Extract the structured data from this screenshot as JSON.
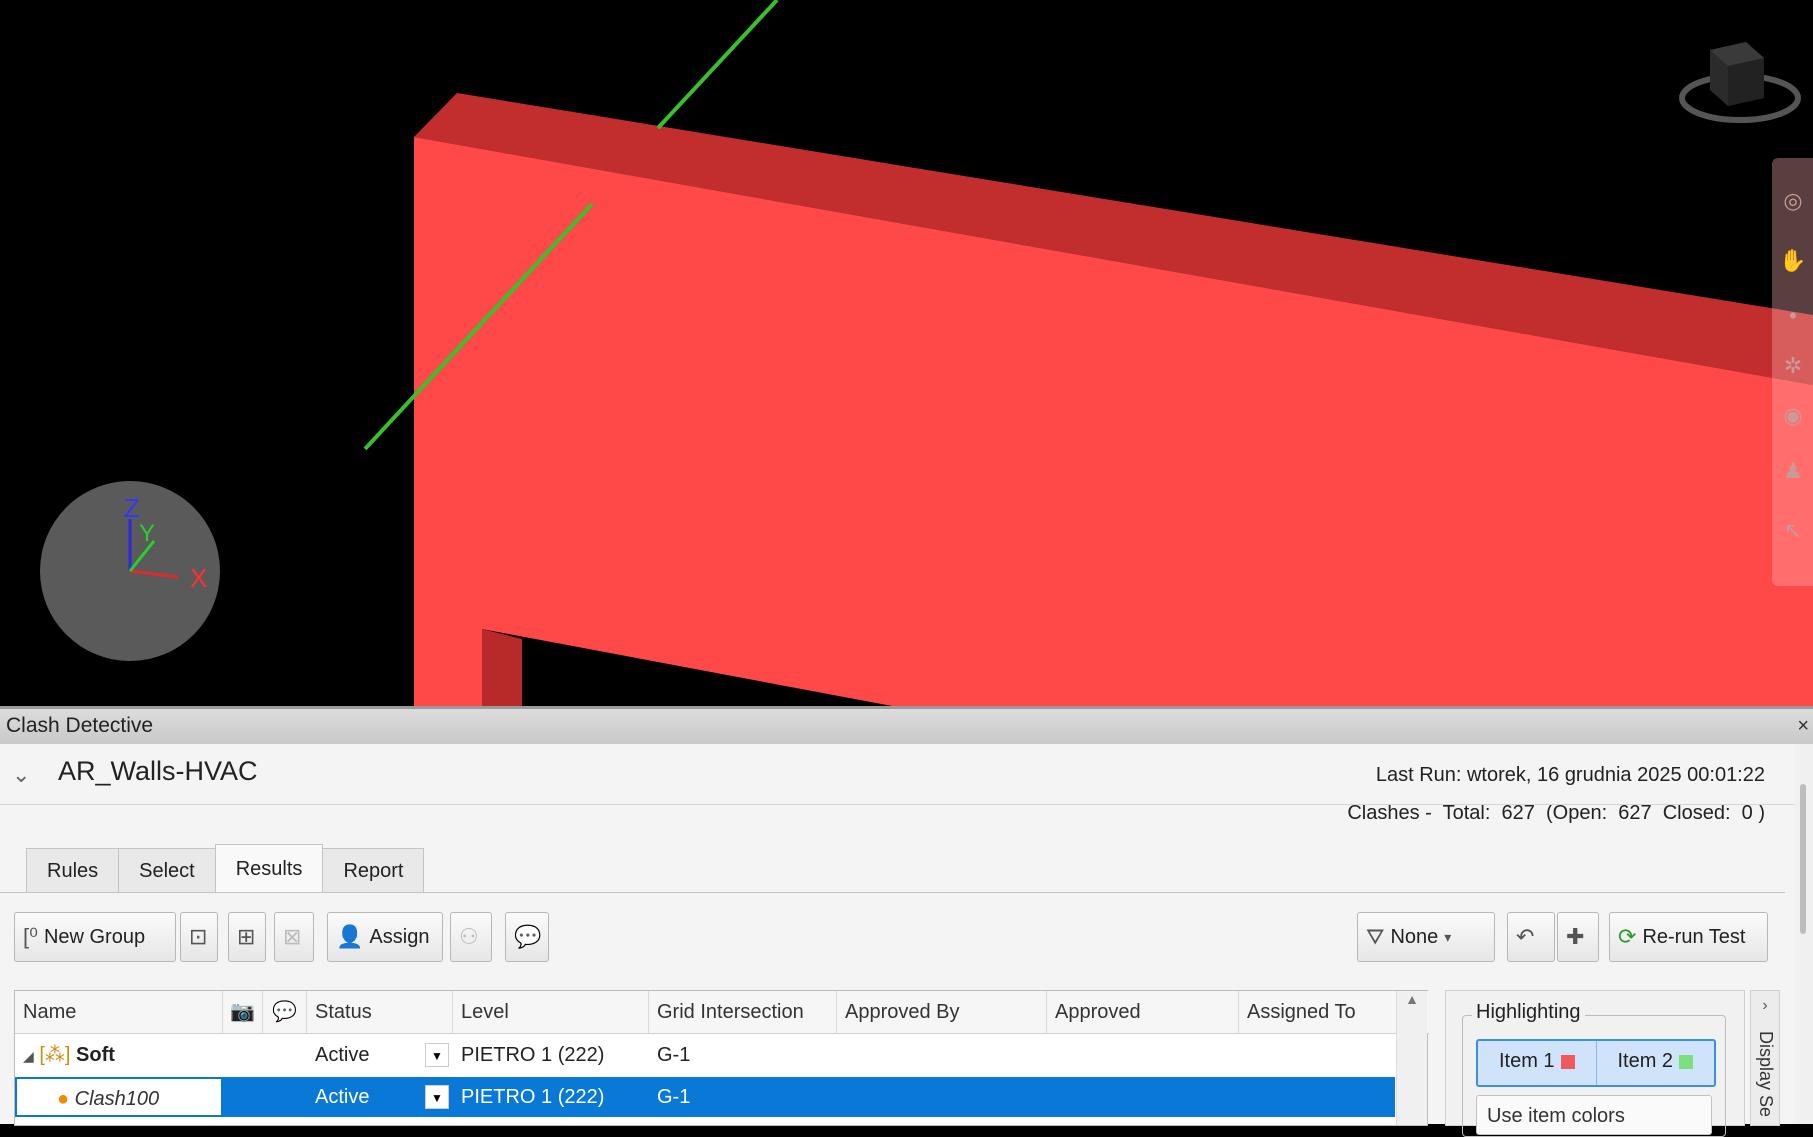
{
  "panel": {
    "title": "Clash Detective",
    "close_glyph": "×"
  },
  "test": {
    "name": "AR_Walls-HVAC",
    "last_run": "Last Run:  wtorek, 16 grudnia 2025 00:01:22",
    "clash_summary": "Clashes -  Total:  627  (Open:  627  Closed:  0 )"
  },
  "tabs": [
    "Rules",
    "Select",
    "Results",
    "Report"
  ],
  "active_tab": "Results",
  "toolbar": {
    "new_group": "New Group",
    "assign": "Assign",
    "filter": "None",
    "rerun": "Re-run Test"
  },
  "columns": [
    "Name",
    "Status",
    "Level",
    "Grid Intersection",
    "Approved By",
    "Approved",
    "Assigned To"
  ],
  "rows": [
    {
      "name": "Soft",
      "status": "Active",
      "level": "PIETRO 1 (222)",
      "grid": "G-1",
      "selected": false,
      "type": "group"
    },
    {
      "name": "Clash100",
      "status": "Active",
      "level": "PIETRO 1 (222)",
      "grid": "G-1",
      "selected": true,
      "type": "clash"
    }
  ],
  "highlighting": {
    "title": "Highlighting",
    "item1": "Item 1",
    "item2": "Item 2",
    "item1_color": "#ef5b5b",
    "item2_color": "#7de07d",
    "mode": "Use item colors"
  },
  "display_settings": "Display Se",
  "axes": {
    "x": "X",
    "y": "Y",
    "z": "Z"
  },
  "colors": {
    "wall_front": "#ff4848",
    "wall_top": "#c22e2e",
    "duct_line": "#38c12b",
    "selection": "#0a78d7"
  }
}
